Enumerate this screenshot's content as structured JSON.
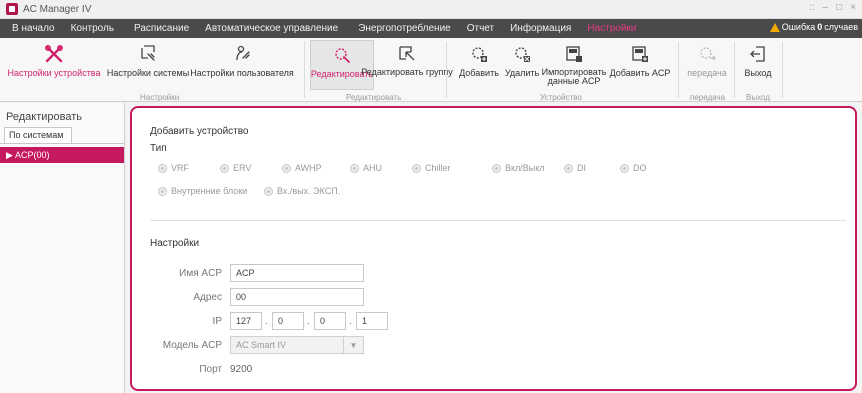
{
  "window": {
    "title": "AC Manager IV",
    "controls": [
      "::",
      "–",
      "□",
      "×"
    ]
  },
  "menu": {
    "items": [
      "В начало",
      "Контроль",
      "Расписание",
      "Автоматическое управление",
      "Энергопотребление",
      "Отчет",
      "Информация",
      "Настройки"
    ],
    "active": "Настройки",
    "alarm": {
      "label": "Ошибка",
      "count": "0",
      "suffix": "случаев"
    }
  },
  "ribbon": {
    "buttons": [
      {
        "label": "Настройки устройства",
        "icon": "tools-icon"
      },
      {
        "label": "Настройки системы",
        "icon": "system-settings-icon"
      },
      {
        "label": "Настройки пользователя",
        "icon": "user-settings-icon"
      },
      {
        "label": "Редактировать",
        "icon": "edit-icon"
      },
      {
        "label": "Редактировать группу",
        "icon": "edit-group-icon"
      },
      {
        "label": "Добавить",
        "icon": "add-device-icon"
      },
      {
        "label": "Удалить",
        "icon": "delete-device-icon"
      },
      {
        "label": "Импортировать данные ACP",
        "icon": "import-acp-icon"
      },
      {
        "label": "Добавить ACP",
        "icon": "add-acp-icon"
      },
      {
        "label": "передача",
        "icon": "transfer-icon"
      },
      {
        "label": "Выход",
        "icon": "exit-icon"
      }
    ],
    "groups": [
      "Настройки",
      "Редактировать",
      "Устройство",
      "передача",
      "Выход"
    ]
  },
  "left_panel": {
    "title": "Редактировать",
    "tab": "По системам",
    "items": [
      "ACP(00)"
    ]
  },
  "main": {
    "add_device_title": "Добавить устройство",
    "type_label": "Тип",
    "types_row1": [
      "VRF",
      "ERV",
      "AWHP",
      "AHU",
      "Chiller",
      "Вкл/Выкл",
      "DI",
      "DO"
    ],
    "types_row2": [
      "Внутренние блоки",
      "Вх./вых. ЭКСП."
    ],
    "settings_title": "Настройки",
    "fields": {
      "acp_name_label": "Имя ACP",
      "acp_name_value": "ACP",
      "address_label": "Адрес",
      "address_value": "00",
      "ip_label": "IP",
      "ip_values": [
        "127",
        "0",
        "0",
        "1"
      ],
      "model_label": "Модель ACP",
      "model_value": "AC Smart IV",
      "port_label": "Порт",
      "port_value": "9200"
    }
  },
  "colors": {
    "accent": "#c5195f",
    "menu_bg": "#4a4a4a",
    "active_menu": "#e43a86",
    "alarm": "#f2a900"
  }
}
